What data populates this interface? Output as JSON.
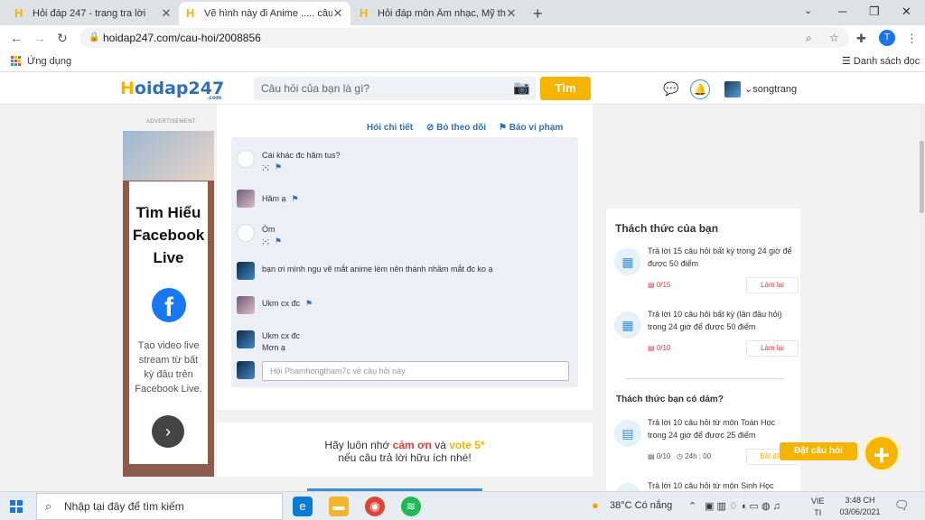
{
  "browser": {
    "tabs": [
      {
        "title": "Hỏi đáp 247 - trang tra lời",
        "active": false
      },
      {
        "title": "Vẽ hình này đi Anime ..... câu hỏi 2008856",
        "active": true
      },
      {
        "title": "Hỏi đáp môn Âm nhạc, Mỹ thuật, ...",
        "active": false
      }
    ],
    "url": "hoidap247.com/cau-hoi/2008856",
    "profile_initial": "T",
    "bookmarks_label": "Ứng dụng",
    "reading_list": "Danh sách đọc"
  },
  "header": {
    "logo_main": "oidap",
    "logo_h": "H",
    "logo_num": "247",
    "logo_com": ".com",
    "search_placeholder": "Câu hỏi của bạn là gì?",
    "search_button": "Tìm",
    "username": "songtrang"
  },
  "ad": {
    "label": "ADVERTISEMENT",
    "title": "Tìm Hiểu Facebook Live",
    "body": "Tạo video live stream từ bất kỳ đâu trên Facebook Live."
  },
  "question_actions": {
    "ask_detail": "Hỏi chi tiết",
    "unfollow": "Bỏ theo dõi",
    "report": "Báo vi phạm"
  },
  "comments": [
    {
      "lines": [
        "Cái khác đc hăm tus?",
        ";-;"
      ],
      "avatar": "blank"
    },
    {
      "lines": [
        "Hăm ạ"
      ],
      "avatar": "girl"
    },
    {
      "lines": [
        "Òm",
        ";-;"
      ],
      "avatar": "blank"
    },
    {
      "lines": [
        "bạn ơi mình ngu vẽ mắt anime lém nên thành nhầm mắt đc ko ạ"
      ],
      "avatar": "dark"
    },
    {
      "lines": [
        "Ukm cx đc"
      ],
      "avatar": "girl"
    },
    {
      "lines": [
        "Ukm cx đc",
        "Mơn ạ"
      ],
      "avatar": "dark"
    }
  ],
  "reply_placeholder": "Hỏi Phamhongtham7c về câu hỏi này",
  "reminder": {
    "prefix": "Hãy luôn nhớ ",
    "thanks": "cảm ơn",
    "and": " và ",
    "vote": "vote 5*",
    "line2": "nếu câu trả lời hữu ích nhé!"
  },
  "challenges": {
    "title": "Thách thức của bạn",
    "items": [
      {
        "text": "Trả lời 15 câu hỏi bất kỳ trong 24 giờ để được 50 điểm",
        "progress": "0/15",
        "button": "Làm lại"
      },
      {
        "text": "Trả lời 10 câu hỏi bất kỳ (lần đầu hỏi) trong 24 giờ để được 50 điểm",
        "progress": "0/10",
        "button": "Làm lại"
      }
    ],
    "dare_title": "Thách thức bạn có dám?",
    "dare_items": [
      {
        "text": "Trả lời 10 câu hỏi từ môn Toán Học trong 24 giờ để được 25 điểm",
        "progress": "0/10",
        "time": "24h : 00",
        "button": "Bắt đầu"
      },
      {
        "text": "Trả lời 10 câu hỏi từ môn Sinh Học"
      }
    ],
    "fab_label": "Đặt câu hỏi"
  },
  "taskbar": {
    "search": "Nhập tại đây để tìm kiếm",
    "weather": "38°C  Có nắng",
    "lang_top": "VIE",
    "lang_bottom": "TI",
    "time": "3:48 CH",
    "date": "03/06/2021"
  },
  "colors": {
    "accent_blue": "#2f6fb5",
    "accent_yellow": "#f4b400",
    "red": "#e53935"
  }
}
